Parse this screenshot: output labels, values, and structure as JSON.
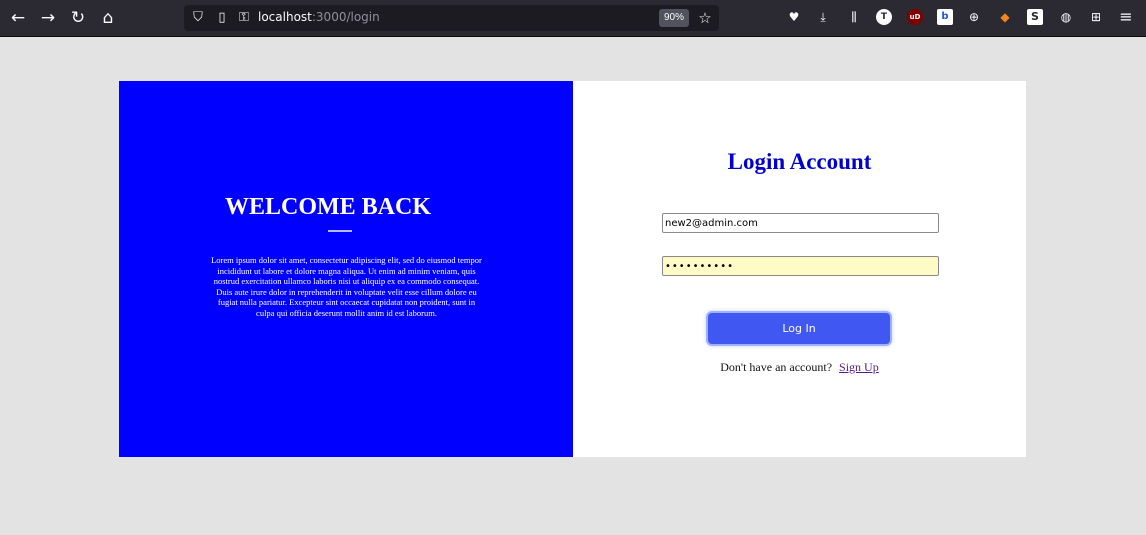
{
  "browser": {
    "url_host": "localhost",
    "url_rest": ":3000/login",
    "zoom": "90%",
    "icons": {
      "back": "←",
      "forward": "→",
      "reload": "↻",
      "home": "⌂",
      "shield": "⛉",
      "page": "▯",
      "key": "⚿",
      "star": "☆",
      "pocket": "♥",
      "download": "⤓",
      "library": "⫼",
      "ext_t": "T",
      "ext_ub": "uD",
      "ext_blue": "b",
      "ext_pad": "⊕",
      "ext_fox": "◆",
      "ext_s": "S",
      "ext_cookie": "◍",
      "ext_puzzle": "⊞",
      "menu": "≡"
    }
  },
  "left": {
    "heading": "WELCOME BACK",
    "body": "Lorem ipsum dolor sit amet, consectetur adipiscing elit, sed do eiusmod tempor incididunt ut labore et dolore magna aliqua. Ut enim ad minim veniam, quis nostrud exercitation ullamco laboris nisi ut aliquip ex ea commodo consequat. Duis aute irure dolor in reprehenderit in voluptate velit esse cillum dolore eu fugiat nulla pariatur. Excepteur sint occaecat cupidatat non proident, sunt in culpa qui officia deserunt mollit anim id est laborum."
  },
  "right": {
    "title": "Login Account",
    "email_value": "new2@admin.com",
    "password_value": "••••••••••",
    "login_label": "Log In",
    "signup_prompt": "Don't have an account?",
    "signup_link": "Sign Up"
  },
  "colors": {
    "left_panel": "#0000ff",
    "button": "#4057f2",
    "title": "#0000d0"
  }
}
